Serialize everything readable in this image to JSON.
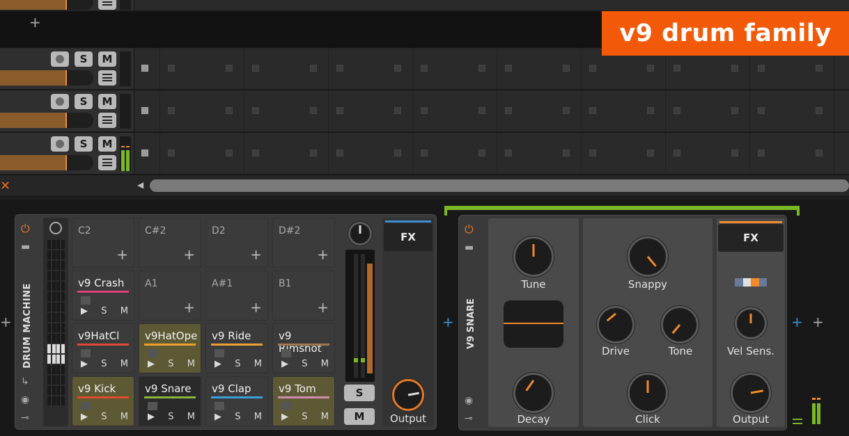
{
  "overlay": {
    "title": "v9 drum family"
  },
  "arranger": {
    "add_track_icon": "plus-icon",
    "solo_label": "S",
    "mute_label": "M",
    "close_icon": "close-icon",
    "scroll_left_icon": "chevron-left-icon"
  },
  "drum_machine": {
    "title": "DRUM MACHINE",
    "pads": [
      {
        "name": "C2"
      },
      {
        "name": "C#2"
      },
      {
        "name": "D2"
      },
      {
        "name": "D#2"
      },
      {
        "name": "v9 Crash",
        "play": "▶",
        "solo": "S",
        "mute": "M",
        "color": "#e0407a"
      },
      {
        "name": "A1"
      },
      {
        "name": "A#1"
      },
      {
        "name": "B1"
      },
      {
        "name": "v9HatCl",
        "play": "▶",
        "solo": "S",
        "mute": "M",
        "color": "#e0483c"
      },
      {
        "name": "v9HatOpe",
        "play": "▶",
        "solo": "S",
        "mute": "M",
        "color": "#f0a030"
      },
      {
        "name": "v9 Ride",
        "play": "▶",
        "solo": "S",
        "mute": "M",
        "color": "#f0a030"
      },
      {
        "name": "v9 Rimshot",
        "play": "▶",
        "solo": "S",
        "mute": "M",
        "color": "#a07850"
      },
      {
        "name": "v9 Kick",
        "play": "▶",
        "solo": "S",
        "mute": "M",
        "color": "#e04a30"
      },
      {
        "name": "v9 Snare",
        "play": "▶",
        "solo": "S",
        "mute": "M",
        "color": "#8cb43c"
      },
      {
        "name": "v9 Clap",
        "play": "▶",
        "solo": "S",
        "mute": "M",
        "color": "#3aa0d8"
      },
      {
        "name": "v9 Tom",
        "play": "▶",
        "solo": "S",
        "mute": "M",
        "color": "#d08cb0"
      }
    ],
    "solo_label": "S",
    "mute_label": "M",
    "fx_label": "FX",
    "output_label": "Output"
  },
  "snare": {
    "title": "V9 SNARE",
    "fx_label": "FX",
    "knobs": {
      "tune": "Tune",
      "decay": "Decay",
      "snappy": "Snappy",
      "drive": "Drive",
      "tone": "Tone",
      "click": "Click",
      "vel_sens": "Vel Sens.",
      "output": "Output"
    }
  },
  "colors": {
    "accent": "#f25a0a",
    "meter": "#7ab828",
    "knob_pointer": "#f28a2c"
  }
}
